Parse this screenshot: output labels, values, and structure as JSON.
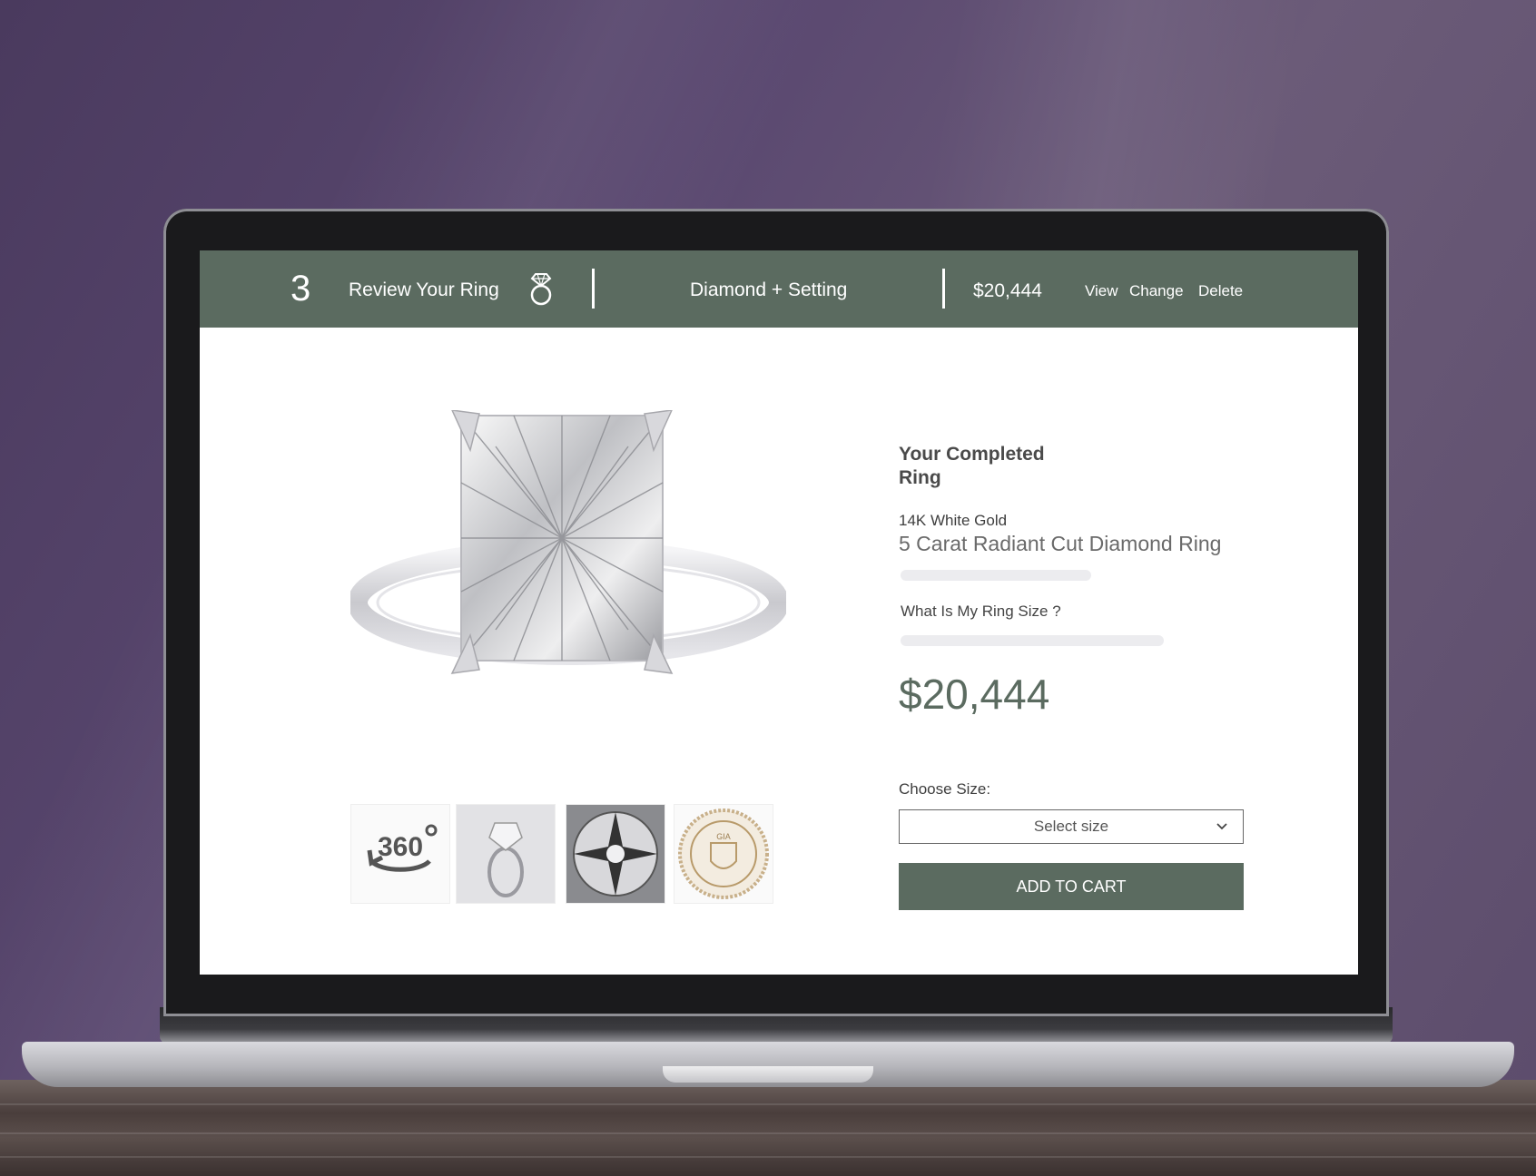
{
  "header": {
    "step_number": "3",
    "step_title": "Review Your Ring",
    "ring_icon": "diamond-ring-icon",
    "combination": "Diamond + Setting",
    "price": "$20,444",
    "actions": [
      "View",
      "Change",
      "Delete"
    ]
  },
  "gallery": {
    "main_image": "radiant-cut-diamond-ring",
    "thumbnails": [
      {
        "label": "360",
        "icon": "rotate-360-icon"
      },
      {
        "label": "",
        "icon": "ring-side-view"
      },
      {
        "label": "",
        "icon": "diamond-top-view"
      },
      {
        "label": "GIA",
        "icon": "gia-seal"
      }
    ]
  },
  "details": {
    "heading_line1": "Your Completed",
    "heading_line2": "Ring",
    "metal": "14K White Gold",
    "name": "5 Carat Radiant Cut Diamond Ring",
    "ring_size_question": "What Is My Ring Size ?",
    "price": "$20,444",
    "choose_size_label": "Choose Size:",
    "select_placeholder": "Select size",
    "add_to_cart": "ADD TO CART"
  },
  "colors": {
    "accent": "#5b6b60",
    "background": "#4a3a5e"
  }
}
